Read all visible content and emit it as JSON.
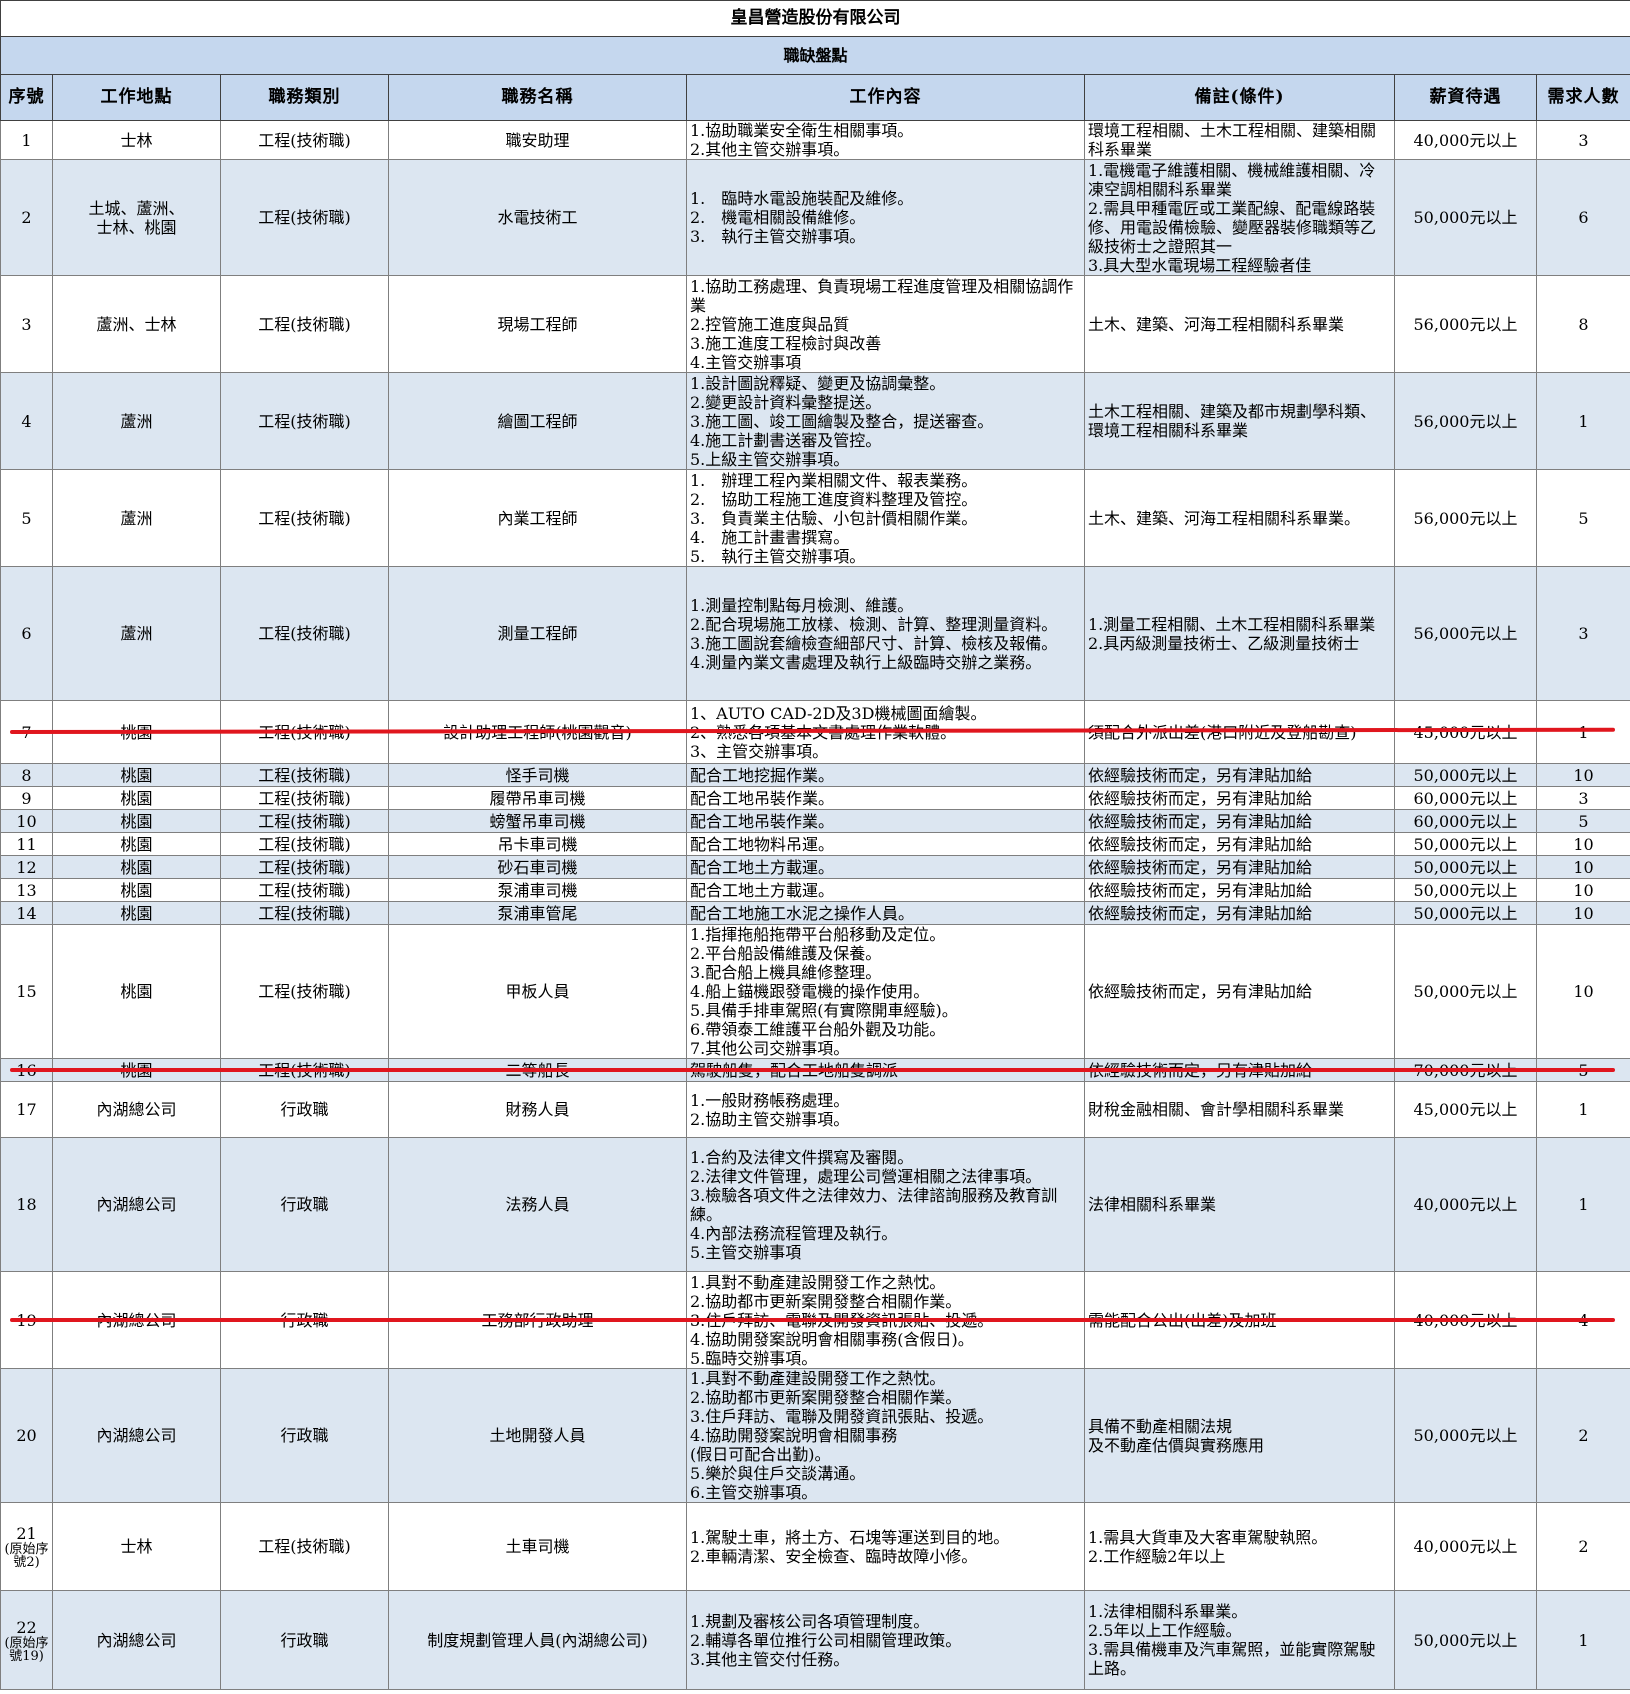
{
  "title": "皇昌營造股份有限公司",
  "subtitle": "職缺盤點",
  "headers": [
    "序號",
    "工作地點",
    "職務類別",
    "職務名稱",
    "工作內容",
    "備註(條件)",
    "薪資待遇",
    "需求人數"
  ],
  "strike_color": "#e0161e",
  "rows": [
    {
      "seq": "1",
      "seq_note": "",
      "location": "士林",
      "category": "工程(技術職)",
      "title": "職安助理",
      "duties": "1.協助職業安全衛生相關事項。\n2.其他主管交辦事項。",
      "remarks": "環境工程相關、土木工程相關、建築相關科系畢業",
      "salary": "40,000元以上",
      "count": "3"
    },
    {
      "seq": "2",
      "seq_note": "",
      "location": "土城、蘆洲、\n士林、桃園",
      "category": "工程(技術職)",
      "title": "水電技術工",
      "duties": "1.　臨時水電設施裝配及維修。\n2.　機電相關設備維修。\n3.　執行主管交辦事項。",
      "remarks": "1.電機電子維護相關、機械維護相關、冷凍空調相關科系畢業\n2.需具甲種電匠或工業配線、配電線路裝修、用電設備檢驗、變壓器裝修職類等乙級技術士之證照其一\n3.具大型水電現場工程經驗者佳",
      "salary": "50,000元以上",
      "count": "6"
    },
    {
      "seq": "3",
      "seq_note": "",
      "location": "蘆洲、士林",
      "category": "工程(技術職)",
      "title": "現場工程師",
      "duties": "1.協助工務處理、負責現場工程進度管理及相關協調作業\n2.控管施工進度與品質\n3.施工進度工程檢討與改善\n4.主管交辦事項",
      "remarks": "土木、建築、河海工程相關科系畢業",
      "salary": "56,000元以上",
      "count": "8"
    },
    {
      "seq": "4",
      "seq_note": "",
      "location": "蘆洲",
      "category": "工程(技術職)",
      "title": "繪圖工程師",
      "duties": "1.設計圖說釋疑、變更及協調彙整。\n2.變更設計資料彙整提送。\n3.施工圖、竣工圖繪製及整合，提送審查。\n4.施工計劃書送審及管控。\n5.上級主管交辦事項。",
      "remarks": "土木工程相關、建築及都市規劃學科類、環境工程相關科系畢業",
      "salary": "56,000元以上",
      "count": "1"
    },
    {
      "seq": "5",
      "seq_note": "",
      "location": "蘆洲",
      "category": "工程(技術職)",
      "title": "內業工程師",
      "duties": "1.　辦理工程內業相關文件、報表業務。\n2.　協助工程施工進度資料整理及管控。\n3.　負責業主估驗、小包計價相關作業。\n4.　施工計畫書撰寫。\n5.　執行主管交辦事項。",
      "remarks": "土木、建築、河海工程相關科系畢業。",
      "salary": "56,000元以上",
      "count": "5"
    },
    {
      "seq": "6",
      "seq_note": "",
      "location": "蘆洲",
      "category": "工程(技術職)",
      "title": "測量工程師",
      "duties": "1.測量控制點每月檢測、維護。\n2.配合現場施工放樣、檢測、計算、整理測量資料。\n3.施工圖說套繪檢查細部尺寸、計算、檢核及報備。\n4.測量內業文書處理及執行上級臨時交辦之業務。",
      "remarks": "1.測量工程相關、土木工程相關科系畢業\n2.具丙級測量技術士、乙級測量技術士",
      "salary": "56,000元以上",
      "count": "3"
    },
    {
      "seq": "7",
      "seq_note": "",
      "location": "桃園",
      "category": "工程(技術職)",
      "title": "設計助理工程師(桃園觀音)",
      "duties": "1、AUTO CAD-2D及3D機械圖面繪製。\n2、熟悉各項基本文書處理作業軟體。\n3、主管交辦事項。",
      "remarks": "須配合外派出差(港口附近及登船勘查)",
      "salary": "45,000元以上",
      "count": "1"
    },
    {
      "seq": "8",
      "seq_note": "",
      "location": "桃園",
      "category": "工程(技術職)",
      "title": "怪手司機",
      "duties": "配合工地挖掘作業。",
      "remarks": "依經驗技術而定，另有津貼加給",
      "salary": "50,000元以上",
      "count": "10"
    },
    {
      "seq": "9",
      "seq_note": "",
      "location": "桃園",
      "category": "工程(技術職)",
      "title": "履帶吊車司機",
      "duties": "配合工地吊裝作業。",
      "remarks": "依經驗技術而定，另有津貼加給",
      "salary": "60,000元以上",
      "count": "3"
    },
    {
      "seq": "10",
      "seq_note": "",
      "location": "桃園",
      "category": "工程(技術職)",
      "title": "螃蟹吊車司機",
      "duties": "配合工地吊裝作業。",
      "remarks": "依經驗技術而定，另有津貼加給",
      "salary": "60,000元以上",
      "count": "5"
    },
    {
      "seq": "11",
      "seq_note": "",
      "location": "桃園",
      "category": "工程(技術職)",
      "title": "吊卡車司機",
      "duties": "配合工地物料吊運。",
      "remarks": "依經驗技術而定，另有津貼加給",
      "salary": "50,000元以上",
      "count": "10"
    },
    {
      "seq": "12",
      "seq_note": "",
      "location": "桃園",
      "category": "工程(技術職)",
      "title": "砂石車司機",
      "duties": "配合工地土方載運。",
      "remarks": "依經驗技術而定，另有津貼加給",
      "salary": "50,000元以上",
      "count": "10"
    },
    {
      "seq": "13",
      "seq_note": "",
      "location": "桃園",
      "category": "工程(技術職)",
      "title": "泵浦車司機",
      "duties": "配合工地土方載運。",
      "remarks": "依經驗技術而定，另有津貼加給",
      "salary": "50,000元以上",
      "count": "10"
    },
    {
      "seq": "14",
      "seq_note": "",
      "location": "桃園",
      "category": "工程(技術職)",
      "title": "泵浦車管尾",
      "duties": "配合工地施工水泥之操作人員。",
      "remarks": "依經驗技術而定，另有津貼加給",
      "salary": "50,000元以上",
      "count": "10"
    },
    {
      "seq": "15",
      "seq_note": "",
      "location": "桃園",
      "category": "工程(技術職)",
      "title": "甲板人員",
      "duties": "1.指揮拖船拖帶平台船移動及定位。\n2.平台船設備維護及保養。\n3.配合船上機具維修整理。\n4.船上錨機跟發電機的操作使用。\n5.具備手排車駕照(有實際開車經驗)。\n6.帶領泰工維護平台船外觀及功能。\n7.其他公司交辦事項。",
      "remarks": "依經驗技術而定，另有津貼加給",
      "salary": "50,000元以上",
      "count": "10"
    },
    {
      "seq": "16",
      "seq_note": "",
      "location": "桃園",
      "category": "工程(技術職)",
      "title": "二等船長",
      "duties": "駕駛船隻，配合工地船隻調派",
      "remarks": "依經驗技術而定，另有津貼加給",
      "salary": "70,000元以上",
      "count": "5"
    },
    {
      "seq": "17",
      "seq_note": "",
      "location": "內湖總公司",
      "category": "行政職",
      "title": "財務人員",
      "duties": "1.一般財務帳務處理。\n2.協助主管交辦事項。",
      "remarks": "財稅金融相關、會計學相關科系畢業",
      "salary": "45,000元以上",
      "count": "1"
    },
    {
      "seq": "18",
      "seq_note": "",
      "location": "內湖總公司",
      "category": "行政職",
      "title": "法務人員",
      "duties": "1.合約及法律文件撰寫及審閱。\n2.法律文件管理，處理公司營運相關之法律事項。\n3.檢驗各項文件之法律效力、法律諮詢服務及教育訓練。\n4.內部法務流程管理及執行。\n5.主管交辦事項",
      "remarks": "法律相關科系畢業",
      "salary": "40,000元以上",
      "count": "1"
    },
    {
      "seq": "19",
      "seq_note": "",
      "location": "內湖總公司",
      "category": "行政職",
      "title": "工務部行政助理",
      "duties": "1.具對不動產建設開發工作之熱忱。\n2.協助都市更新案開發整合相關作業。\n3.住戶拜訪、電聯及開發資訊張貼、投遞。\n4.協助開發案說明會相關事務(含假日)。\n5.臨時交辦事項。",
      "remarks": "需能配合公出(出差)及加班",
      "salary": "40,000元以上",
      "count": "4"
    },
    {
      "seq": "20",
      "seq_note": "",
      "location": "內湖總公司",
      "category": "行政職",
      "title": "土地開發人員",
      "duties": "1.具對不動產建設開發工作之熱忱。\n2.協助都市更新案開發整合相關作業。\n3.住戶拜訪、電聯及開發資訊張貼、投遞。\n4.協助開發案說明會相關事務\n(假日可配合出勤)。\n5.樂於與住戶交談溝通。\n6.主管交辦事項。",
      "remarks": "具備不動產相關法規\n及不動產估價與實務應用",
      "salary": "50,000元以上",
      "count": "2"
    },
    {
      "seq": "21",
      "seq_note": "(原始序號2)",
      "location": "士林",
      "category": "工程(技術職)",
      "title": "土車司機",
      "duties": "1.駕駛土車，將土方、石塊等運送到目的地。\n2.車輛清潔、安全檢查、臨時故障小修。",
      "remarks": "1.需具大貨車及大客車駕駛執照。\n2.工作經驗2年以上",
      "salary": "40,000元以上",
      "count": "2"
    },
    {
      "seq": "22",
      "seq_note": "(原始序號19)",
      "location": "內湖總公司",
      "category": "行政職",
      "title": "制度規劃管理人員(內湖總公司)",
      "duties": "1.規劃及審核公司各項管理制度。\n2.輔導各單位推行公司相關管理政策。\n3.其他主管交付任務。",
      "remarks": "1.法律相關科系畢業。\n2.5年以上工作經驗。\n3.需具備機車及汽車駕照，並能實際駕駛上路。",
      "salary": "50,000元以上",
      "count": "1"
    }
  ]
}
